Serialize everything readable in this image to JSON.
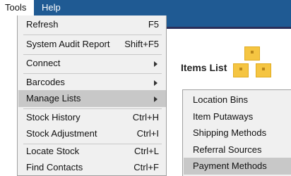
{
  "menubar": {
    "items": [
      {
        "label": "Tools"
      },
      {
        "label": "Help"
      }
    ]
  },
  "background": {
    "title": "Items List",
    "icon": "stacked-boxes-icon",
    "accent_color": "#1f5a93"
  },
  "tools_menu": {
    "items": [
      {
        "label": "Refresh",
        "shortcut": "F5"
      },
      {
        "label": "System Audit Report",
        "shortcut": "Shift+F5"
      },
      {
        "label": "Connect",
        "submenu": true
      },
      {
        "label": "Barcodes",
        "submenu": true
      },
      {
        "label": "Manage Lists",
        "submenu": true,
        "highlighted": true
      },
      {
        "label": "Stock History",
        "shortcut": "Ctrl+H"
      },
      {
        "label": "Stock Adjustment",
        "shortcut": "Ctrl+I"
      },
      {
        "label": "Locate Stock",
        "shortcut": "Ctrl+L"
      },
      {
        "label": "Find Contacts",
        "shortcut": "Ctrl+F"
      }
    ]
  },
  "manage_lists_submenu": {
    "items": [
      {
        "label": "Location Bins"
      },
      {
        "label": "Item Putaways"
      },
      {
        "label": "Shipping Methods"
      },
      {
        "label": "Referral Sources"
      },
      {
        "label": "Payment Methods",
        "highlighted": true
      }
    ]
  }
}
